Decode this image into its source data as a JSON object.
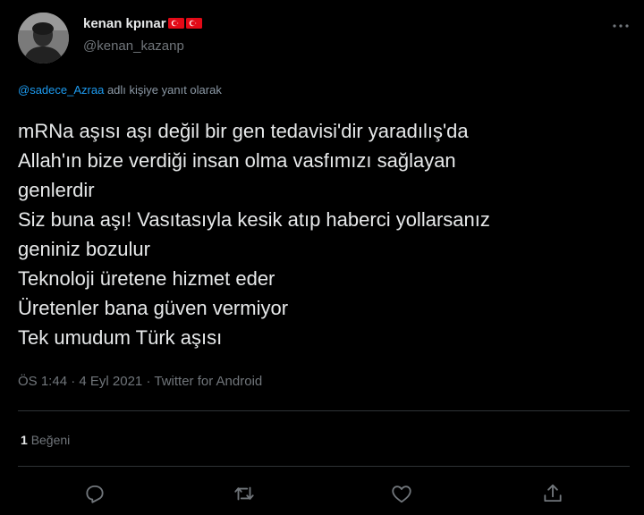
{
  "author": {
    "display_name": "kenan kpınar",
    "handle": "@kenan_kazanp",
    "flag_emojis": [
      "🇹🇷",
      "🇹🇷"
    ]
  },
  "reply": {
    "mention": "@sadece_Azraa",
    "suffix": "adlı kişiye yanıt olarak"
  },
  "tweet": {
    "lines": [
      "mRNa aşısı aşı değil bir gen tedavisi'dir yaradılış'da",
      "Allah'ın bize verdiği insan olma vasfımızı sağlayan",
      "genlerdir",
      "Siz buna aşı! Vasıtasıyla kesik atıp haberci yollarsanız",
      "geniniz bozulur",
      "Teknoloji üretene hizmet eder",
      "Üretenler bana güven vermiyor",
      "Tek umudum Türk aşısı"
    ]
  },
  "meta": {
    "time": "ÖS 1:44",
    "date": "4 Eyl 2021",
    "source": "Twitter for Android"
  },
  "engagement": {
    "likes_count": "1",
    "likes_label": "Beğeni"
  },
  "icons": {
    "more": "more-horizontal-icon",
    "reply": "reply-icon",
    "retweet": "retweet-icon",
    "like": "heart-icon",
    "share": "share-icon"
  },
  "colors": {
    "background": "#000000",
    "text": "#e7e9ea",
    "secondary": "#71767b",
    "link": "#1d9bf0",
    "divider": "#2f3336",
    "flag_red": "#e30a17"
  }
}
